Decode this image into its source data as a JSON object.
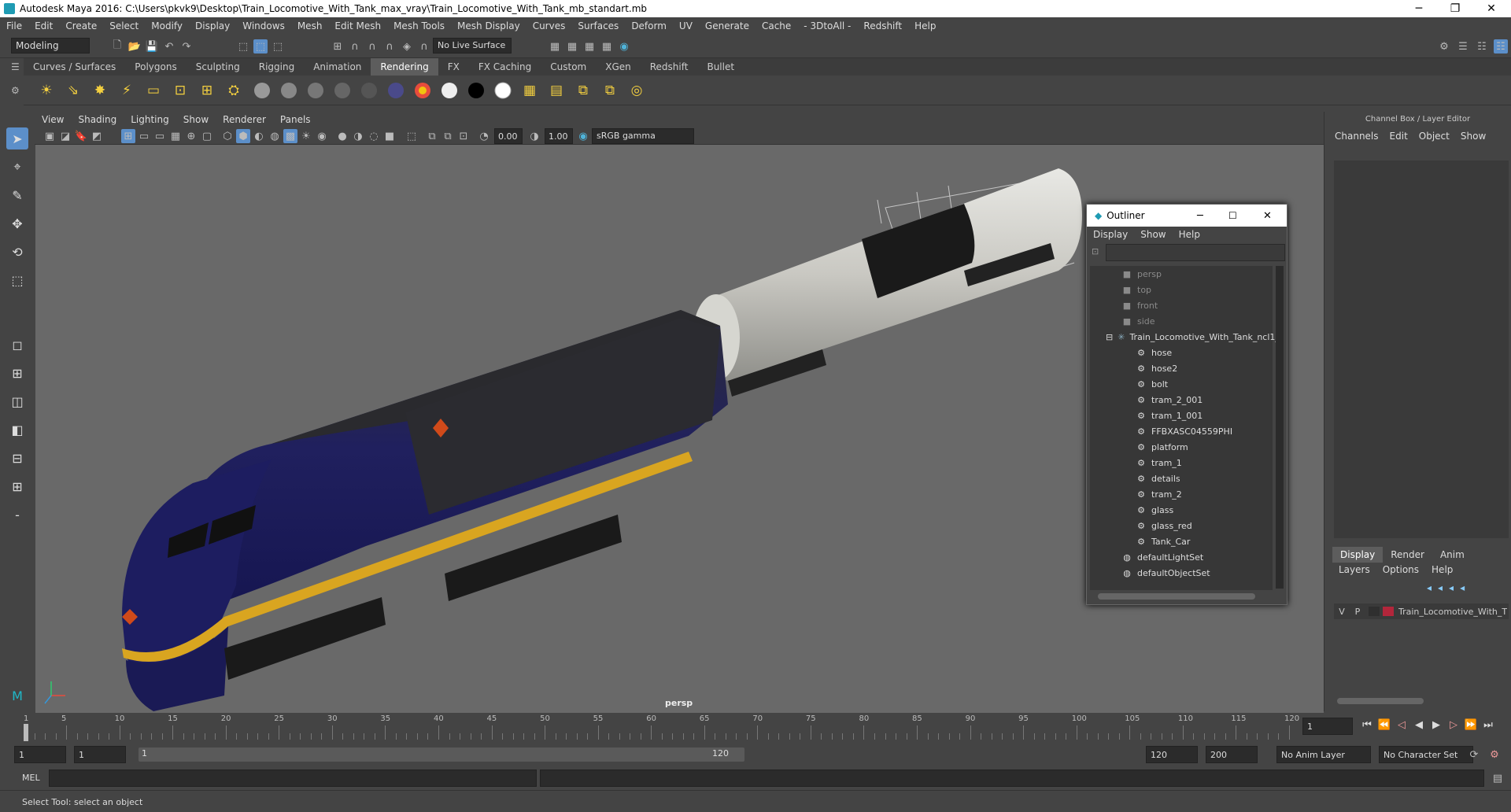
{
  "window": {
    "title": "Autodesk Maya 2016: C:\\Users\\pkvk9\\Desktop\\Train_Locomotive_With_Tank_max_vray\\Train_Locomotive_With_Tank_mb_standart.mb"
  },
  "menu": [
    "File",
    "Edit",
    "Create",
    "Select",
    "Modify",
    "Display",
    "Windows",
    "Mesh",
    "Edit Mesh",
    "Mesh Tools",
    "Mesh Display",
    "Curves",
    "Surfaces",
    "Deform",
    "UV",
    "Generate",
    "Cache",
    "- 3DtoAll -",
    "Redshift",
    "Help"
  ],
  "statusline": {
    "mode": "Modeling",
    "live_surface": "No Live Surface"
  },
  "shelf_tabs": [
    "Curves / Surfaces",
    "Polygons",
    "Sculpting",
    "Rigging",
    "Animation",
    "Rendering",
    "FX",
    "FX Caching",
    "Custom",
    "XGen",
    "Redshift",
    "Bullet"
  ],
  "active_shelf_tab": "Rendering",
  "viewport": {
    "menu": [
      "View",
      "Shading",
      "Lighting",
      "Show",
      "Renderer",
      "Panels"
    ],
    "exposure": "0.00",
    "gamma": "1.00",
    "colorspace": "sRGB gamma",
    "camera_label": "persp"
  },
  "outliner": {
    "title": "Outliner",
    "menu": [
      "Display",
      "Show",
      "Help"
    ],
    "items": [
      {
        "label": "persp"
      },
      {
        "label": "top"
      },
      {
        "label": "front"
      },
      {
        "label": "side"
      },
      {
        "label": "Train_Locomotive_With_Tank_ncl1_"
      },
      {
        "label": "hose"
      },
      {
        "label": "hose2"
      },
      {
        "label": "bolt"
      },
      {
        "label": "tram_2_001"
      },
      {
        "label": "tram_1_001"
      },
      {
        "label": "FFBXASC04559PHI"
      },
      {
        "label": "platform"
      },
      {
        "label": "tram_1"
      },
      {
        "label": "details"
      },
      {
        "label": "tram_2"
      },
      {
        "label": "glass"
      },
      {
        "label": "glass_red"
      },
      {
        "label": "Tank_Car"
      },
      {
        "label": "defaultLightSet"
      },
      {
        "label": "defaultObjectSet"
      }
    ]
  },
  "channelbox": {
    "title": "Channel Box / Layer Editor",
    "menu": [
      "Channels",
      "Edit",
      "Object",
      "Show"
    ],
    "layer_tabs": [
      "Display",
      "Render",
      "Anim"
    ],
    "layer_menu": [
      "Layers",
      "Options",
      "Help"
    ],
    "layer": {
      "v": "V",
      "p": "P",
      "name": "Train_Locomotive_With_T"
    }
  },
  "timeline": {
    "ticks": [
      "1",
      "5",
      "10",
      "15",
      "20",
      "25",
      "30",
      "35",
      "40",
      "45",
      "50",
      "55",
      "60",
      "65",
      "70",
      "75",
      "80",
      "85",
      "90",
      "95",
      "100",
      "105",
      "110",
      "115",
      "120"
    ],
    "current_frame": "1"
  },
  "range": {
    "start": "1",
    "start2": "1",
    "slider_start": "1",
    "slider_end": "120",
    "end": "120",
    "max": "200",
    "anim_layer": "No Anim Layer",
    "char_set": "No Character Set"
  },
  "cmd": {
    "label": "MEL"
  },
  "help": {
    "text": "Select Tool: select an object"
  }
}
